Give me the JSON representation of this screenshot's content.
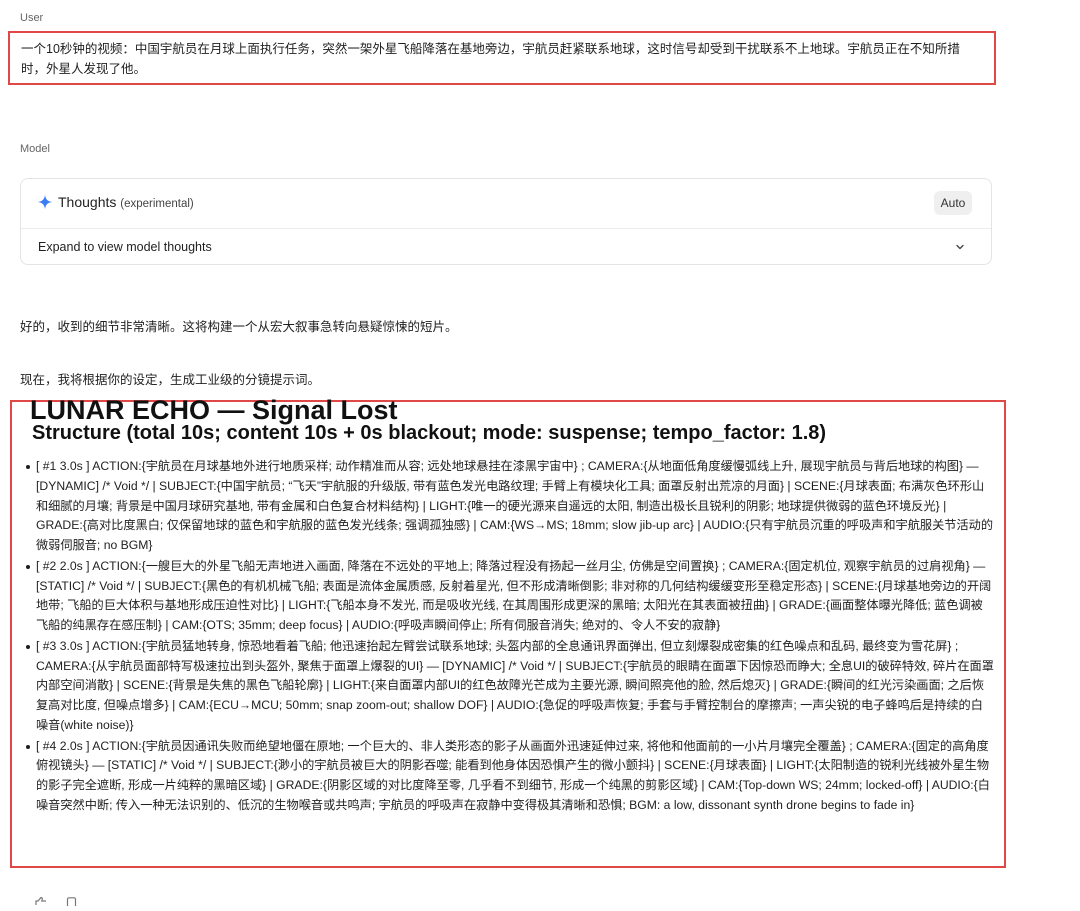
{
  "labels": {
    "user": "User",
    "model": "Model"
  },
  "user_message": "一个10秒钟的视频：中国宇航员在月球上面执行任务，突然一架外星飞船降落在基地旁边，宇航员赶紧联系地球，这时信号却受到干扰联系不上地球。宇航员正在不知所措时，外星人发现了他。",
  "thoughts": {
    "title": "Thoughts",
    "tag": "(experimental)",
    "mode": "Auto",
    "expand_label": "Expand to view model thoughts",
    "icons": {
      "spark": "spark-icon",
      "chevron": "chevron-down-icon"
    }
  },
  "reply": {
    "line1": "好的，收到的细节非常清晰。这将构建一个从宏大叙事急转向悬疑惊悚的短片。",
    "line2": "现在，我将根据你的设定，生成工业级的分镜提示词。"
  },
  "output": {
    "title": "LUNAR ECHO — Signal Lost",
    "subtitle": "Structure (total 10s; content 10s + 0s blackout; mode: suspense; tempo_factor: 1.8)",
    "shots": [
      "[ #1 3.0s ] ACTION:{宇航员在月球基地外进行地质采样; 动作精准而从容; 远处地球悬挂在漆黑宇宙中} ; CAMERA:{从地面低角度缓慢弧线上升, 展现宇航员与背后地球的构图} — [DYNAMIC] /* Void */ | SUBJECT:{中国宇航员; “飞天”宇航服的升级版, 带有蓝色发光电路纹理; 手臂上有模块化工具; 面罩反射出荒凉的月面} | SCENE:{月球表面; 布满灰色环形山和细腻的月壤; 背景是中国月球研究基地, 带有金属和白色复合材料结构} | LIGHT:{唯一的硬光源来自遥远的太阳, 制造出极长且锐利的阴影; 地球提供微弱的蓝色环境反光} | GRADE:{高对比度黑白; 仅保留地球的蓝色和宇航服的蓝色发光线条; 强调孤独感} | CAM:{WS→MS; 18mm; slow jib-up arc} | AUDIO:{只有宇航员沉重的呼吸声和宇航服关节活动的微弱伺服音; no BGM}",
      "[ #2 2.0s ] ACTION:{一艘巨大的外星飞船无声地进入画面, 降落在不远处的平地上; 降落过程没有扬起一丝月尘, 仿佛是空间置换} ; CAMERA:{固定机位, 观察宇航员的过肩视角} — [STATIC] /* Void */ | SUBJECT:{黑色的有机机械飞船; 表面是流体金属质感, 反射着星光, 但不形成清晰倒影; 非对称的几何结构缓缓变形至稳定形态} | SCENE:{月球基地旁边的开阔地带; 飞船的巨大体积与基地形成压迫性对比} | LIGHT:{飞船本身不发光, 而是吸收光线, 在其周围形成更深的黑暗; 太阳光在其表面被扭曲} | GRADE:{画面整体曝光降低; 蓝色调被飞船的纯黑存在感压制} | CAM:{OTS; 35mm; deep focus} | AUDIO:{呼吸声瞬间停止; 所有伺服音消失; 绝对的、令人不安的寂静}",
      "[ #3 3.0s ] ACTION:{宇航员猛地转身, 惊恐地看着飞船; 他迅速抬起左臂尝试联系地球; 头盔内部的全息通讯界面弹出, 但立刻爆裂成密集的红色噪点和乱码, 最终变为雪花屏} ; CAMERA:{从宇航员面部特写极速拉出到头盔外, 聚焦于面罩上爆裂的UI} — [DYNAMIC] /* Void */ | SUBJECT:{宇航员的眼睛在面罩下因惊恐而睁大; 全息UI的破碎特效, 碎片在面罩内部空间消散} | SCENE:{背景是失焦的黑色飞船轮廓} | LIGHT:{来自面罩内部UI的红色故障光芒成为主要光源, 瞬间照亮他的脸, 然后熄灭} | GRADE:{瞬间的红光污染画面; 之后恢复高对比度, 但噪点增多} | CAM:{ECU→MCU; 50mm; snap zoom-out; shallow DOF} | AUDIO:{急促的呼吸声恢复; 手套与手臂控制台的摩擦声; 一声尖锐的电子蜂鸣后是持续的白噪音(white noise)}",
      "[ #4 2.0s ] ACTION:{宇航员因通讯失败而绝望地僵在原地; 一个巨大的、非人类形态的影子从画面外迅速延伸过来, 将他和他面前的一小片月壤完全覆盖} ; CAMERA:{固定的高角度俯视镜头} — [STATIC] /* Void */ | SUBJECT:{渺小的宇航员被巨大的阴影吞噬; 能看到他身体因恐惧产生的微小颤抖} | SCENE:{月球表面} | LIGHT:{太阳制造的锐利光线被外星生物的影子完全遮断, 形成一片纯粹的黑暗区域} | GRADE:{阴影区域的对比度降至零, 几乎看不到细节, 形成一个纯黑的剪影区域} | CAM:{Top-down WS; 24mm; locked-off} | AUDIO:{白噪音突然中断; 传入一种无法识别的、低沉的生物喉音或共鸣声; 宇航员的呼吸声在寂静中变得极其清晰和恐惧; BGM: a low, dissonant synth drone begins to fade in}"
    ]
  },
  "footer": {
    "icons": [
      "thumb-up-icon",
      "copy-icon"
    ]
  },
  "colors": {
    "highlight": "#e04848",
    "accent": "#3b7cf5"
  }
}
